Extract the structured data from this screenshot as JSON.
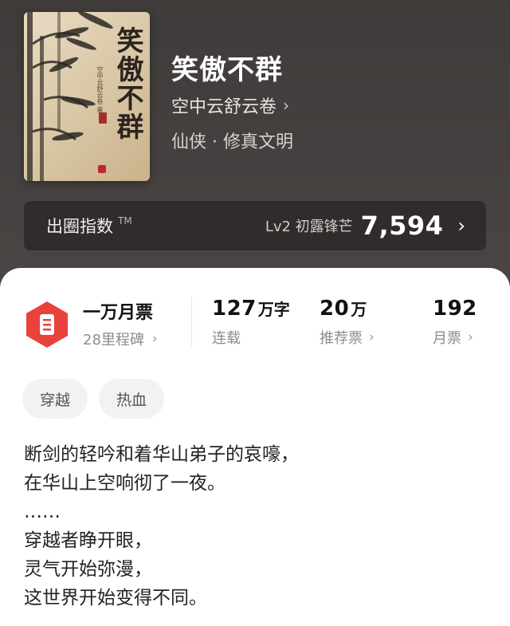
{
  "book": {
    "title": "笑傲不群",
    "author": "空中云舒云卷",
    "genre": "仙侠 · 修真文明",
    "cover_title": "笑傲不群",
    "cover_author": "空中云舒云卷 著"
  },
  "index": {
    "label": "出圈指数",
    "tm": "TM",
    "level": "Lv2 初露锋芒",
    "value": "7,594"
  },
  "tickets": {
    "title": "一万月票",
    "sub": "28里程碑"
  },
  "stats": [
    {
      "num": "127",
      "unit": "万字",
      "label": "连载"
    },
    {
      "num": "20",
      "unit": "万",
      "label": "推荐票"
    },
    {
      "num": "192",
      "unit": "",
      "label": "月票"
    }
  ],
  "tags": [
    "穿越",
    "热血"
  ],
  "intro": [
    "断剑的轻吟和着华山弟子的哀嚎，",
    "在华山上空响彻了一夜。",
    "……",
    "穿越者睁开眼，",
    "灵气开始弥漫，",
    "这世界开始变得不同。"
  ],
  "colors": {
    "accent": "#e8423b",
    "header_bg": "#4a4544",
    "index_bar_bg": "#2f2c2b"
  },
  "icons": {
    "chevron": "chevron-right-icon",
    "badge": "monthly-ticket-icon"
  }
}
